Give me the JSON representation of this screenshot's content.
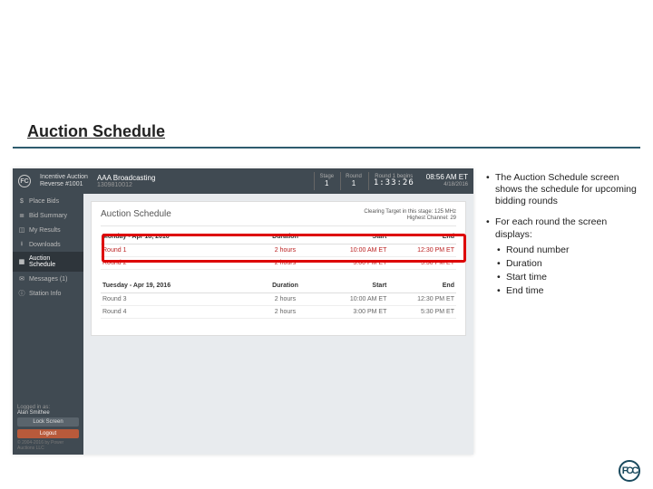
{
  "title": "Auction Schedule",
  "topbar": {
    "app_line1": "Incentive Auction",
    "app_line2": "Reverse #1001",
    "broadcaster": "AAA Broadcasting",
    "broadcaster_sub": "1309810012",
    "stage_lbl": "Stage",
    "stage_val": "1",
    "round_lbl": "Round",
    "round_val": "1",
    "begins_lbl": "Round 1 begins",
    "countdown": "1:33:26",
    "time": "08:56 AM ET",
    "date": "4/18/2016"
  },
  "sidebar": {
    "items": [
      {
        "icon": "$",
        "label": "Place Bids"
      },
      {
        "icon": "≣",
        "label": "Bid Summary"
      },
      {
        "icon": "◫",
        "label": "My Results"
      },
      {
        "icon": "⭳",
        "label": "Downloads"
      },
      {
        "icon": "▦",
        "label": "Auction Schedule"
      },
      {
        "icon": "✉",
        "label": "Messages (1)"
      },
      {
        "icon": "ⓘ",
        "label": "Station Info"
      }
    ],
    "logged_lbl": "Logged in as:",
    "username": "Alan Smithee",
    "lock": "Lock Screen",
    "logout": "Logout",
    "copyright": "© 2004-2016 by Power Auctions LLC"
  },
  "card": {
    "title": "Auction Schedule",
    "clearing1": "Clearing Target in this stage: 125 MHz",
    "clearing2": "Highest Channel: 29",
    "days": [
      {
        "day": "Monday - Apr 18, 2016",
        "h_dur": "Duration",
        "h_start": "Start",
        "h_end": "End",
        "rows": [
          {
            "name": "Round 1",
            "dur": "2 hours",
            "start": "10:00 AM ET",
            "end": "12:30 PM ET",
            "current": true
          },
          {
            "name": "Round 2",
            "dur": "2 hours",
            "start": "3:00 PM ET",
            "end": "5:30 PM ET",
            "current": true
          }
        ]
      },
      {
        "day": "Tuesday - Apr 19, 2016",
        "h_dur": "Duration",
        "h_start": "Start",
        "h_end": "End",
        "rows": [
          {
            "name": "Round 3",
            "dur": "2 hours",
            "start": "10:00 AM ET",
            "end": "12:30 PM ET"
          },
          {
            "name": "Round 4",
            "dur": "2 hours",
            "start": "3:00 PM ET",
            "end": "5:30 PM ET"
          }
        ]
      }
    ]
  },
  "notes": {
    "b1": "The Auction Schedule screen shows the schedule for upcoming bidding rounds",
    "b2": "For each round the screen displays:",
    "s1": "Round number",
    "s2": "Duration",
    "s3": "Start time",
    "s4": "End time"
  },
  "footer_logo": "FCC"
}
